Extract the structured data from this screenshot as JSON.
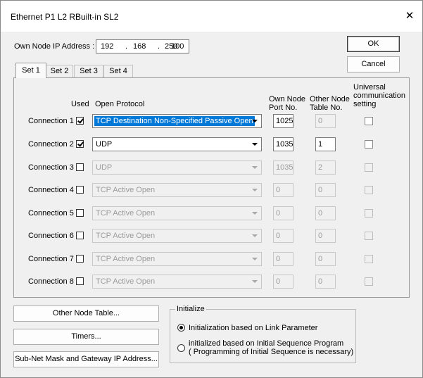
{
  "window": {
    "title": "Ethernet  P1 L2 RBuilt-in SL2",
    "close_glyph": "✕"
  },
  "ip": {
    "label": "Own Node IP Address :",
    "octets": [
      "192",
      "168",
      "250",
      "100"
    ],
    "dots": [
      "."
    ]
  },
  "buttons": {
    "ok": "OK",
    "cancel": "Cancel",
    "other_node_table": "Other Node Table...",
    "timers": "Timers...",
    "subnet": "Sub-Net Mask and Gateway IP Address..."
  },
  "tabs": [
    "Set 1",
    "Set 2",
    "Set 3",
    "Set 4"
  ],
  "headers": {
    "used": "Used",
    "open_protocol": "Open Protocol",
    "own_port_1": "Own Node",
    "own_port_2": "Port No.",
    "other_table_1": "Other Node",
    "other_table_2": "Table No.",
    "universal_1": "Universal",
    "universal_2": "communication",
    "universal_3": "setting"
  },
  "connections": [
    {
      "label": "Connection 1",
      "used": true,
      "protocol": "TCP Destination Non-Specified Passive Open",
      "port": "1025",
      "table": "0",
      "enabled": true,
      "highlight": true,
      "table_enabled": false
    },
    {
      "label": "Connection 2",
      "used": true,
      "protocol": "UDP",
      "port": "1035",
      "table": "1",
      "enabled": true,
      "highlight": false,
      "table_enabled": true
    },
    {
      "label": "Connection 3",
      "used": false,
      "protocol": "UDP",
      "port": "1035",
      "table": "2",
      "enabled": false,
      "highlight": false,
      "table_enabled": false
    },
    {
      "label": "Connection 4",
      "used": false,
      "protocol": "TCP Active Open",
      "port": "0",
      "table": "0",
      "enabled": false,
      "highlight": false,
      "table_enabled": false
    },
    {
      "label": "Connection 5",
      "used": false,
      "protocol": "TCP Active Open",
      "port": "0",
      "table": "0",
      "enabled": false,
      "highlight": false,
      "table_enabled": false
    },
    {
      "label": "Connection 6",
      "used": false,
      "protocol": "TCP Active Open",
      "port": "0",
      "table": "0",
      "enabled": false,
      "highlight": false,
      "table_enabled": false
    },
    {
      "label": "Connection 7",
      "used": false,
      "protocol": "TCP Active Open",
      "port": "0",
      "table": "0",
      "enabled": false,
      "highlight": false,
      "table_enabled": false
    },
    {
      "label": "Connection 8",
      "used": false,
      "protocol": "TCP Active Open",
      "port": "0",
      "table": "0",
      "enabled": false,
      "highlight": false,
      "table_enabled": false
    }
  ],
  "initialize": {
    "title": "Initialize",
    "option1": "Initialization based on Link Parameter",
    "option2_line1": "initialized based on Initial Sequence Program",
    "option2_line2": "( Programming of Initial Sequence is necessary)",
    "selected": 1
  }
}
